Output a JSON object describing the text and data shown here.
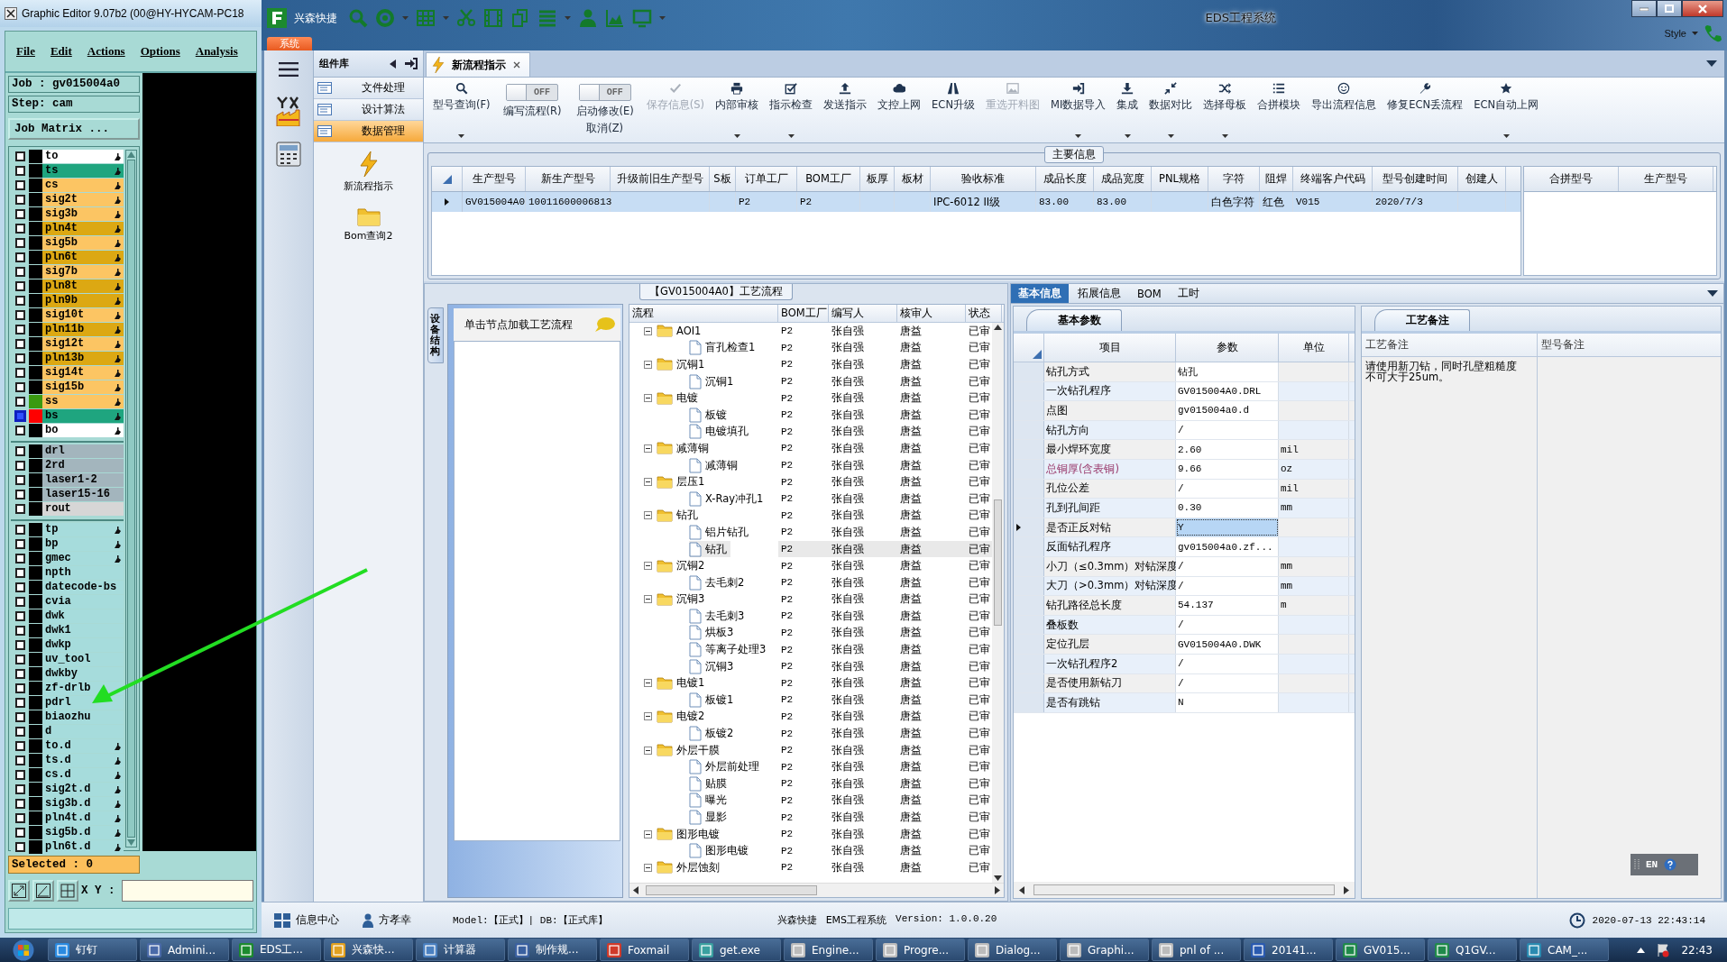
{
  "graphic_editor": {
    "title": "Graphic Editor 9.07b2 (00@HY-HYCAM-PC18",
    "menu": [
      "File",
      "Edit",
      "Actions",
      "Options",
      "Analysis"
    ],
    "job": "Job : gv015004a0",
    "step": "Step: cam",
    "job_matrix_button": "Job Matrix ...",
    "layer_groups": [
      {
        "layers": [
          {
            "name": "to",
            "color": "#ffffff",
            "affected": true,
            "selected": false
          },
          {
            "name": "ts",
            "color": "#1fa57f",
            "affected": true,
            "selected": false
          },
          {
            "name": "cs",
            "color": "#fcc563",
            "affected": true,
            "selected": false
          },
          {
            "name": "sig2t",
            "color": "#fcc563",
            "affected": true,
            "selected": false
          },
          {
            "name": "sig3b",
            "color": "#fcc563",
            "affected": true,
            "selected": false
          },
          {
            "name": "pln4t",
            "color": "#dca813",
            "affected": true,
            "selected": false
          },
          {
            "name": "sig5b",
            "color": "#fcc563",
            "affected": true,
            "selected": false
          },
          {
            "name": "pln6t",
            "color": "#dca813",
            "affected": true,
            "selected": false
          },
          {
            "name": "sig7b",
            "color": "#fcc563",
            "affected": true,
            "selected": false
          },
          {
            "name": "pln8t",
            "color": "#dca813",
            "affected": true,
            "selected": false
          },
          {
            "name": "pln9b",
            "color": "#dca813",
            "affected": true,
            "selected": false
          },
          {
            "name": "sig10t",
            "color": "#fcc563",
            "affected": true,
            "selected": false
          },
          {
            "name": "pln11b",
            "color": "#dca813",
            "affected": true,
            "selected": false
          },
          {
            "name": "sig12t",
            "color": "#fcc563",
            "affected": true,
            "selected": false
          },
          {
            "name": "pln13b",
            "color": "#dca813",
            "affected": true,
            "selected": false
          },
          {
            "name": "sig14t",
            "color": "#fcc563",
            "affected": true,
            "selected": false
          },
          {
            "name": "sig15b",
            "color": "#fcc563",
            "affected": true,
            "selected": false
          },
          {
            "name": "ss",
            "color": "#fcc563",
            "affected": true,
            "selected": false,
            "swatch": {
              "color": "#3a9a10"
            }
          },
          {
            "name": "bs",
            "color": "#1fa57f",
            "affected": true,
            "selected": true,
            "swatch": {
              "color": "#ff0000"
            }
          },
          {
            "name": "bo",
            "color": "#ffffff",
            "affected": true,
            "selected": false
          }
        ]
      },
      {
        "layers": [
          {
            "name": "drl",
            "color": "#a3b5bd",
            "affected": false,
            "selected": false
          },
          {
            "name": "2rd",
            "color": "#a3b5bd",
            "affected": false,
            "selected": false
          },
          {
            "name": "laser1-2",
            "color": "#a3b5bd",
            "affected": false,
            "selected": false
          },
          {
            "name": "laser15-16",
            "color": "#a3b5bd",
            "affected": false,
            "selected": false
          },
          {
            "name": "rout",
            "color": "#d6d6d6",
            "affected": false,
            "selected": false
          }
        ]
      },
      {
        "layers": [
          {
            "name": "tp",
            "color": "#a6dcdc",
            "affected": true,
            "selected": false
          },
          {
            "name": "bp",
            "color": "#a6dcdc",
            "affected": true,
            "selected": false
          },
          {
            "name": "gmec",
            "color": "#a6dcdc",
            "affected": true,
            "selected": false
          },
          {
            "name": "npth",
            "color": "#a6dcdc",
            "affected": false,
            "selected": false
          },
          {
            "name": "datecode-bs",
            "color": "#a6dcdc",
            "affected": false,
            "selected": false
          },
          {
            "name": "cvia",
            "color": "#a6dcdc",
            "affected": false,
            "selected": false
          },
          {
            "name": "dwk",
            "color": "#a6dcdc",
            "affected": false,
            "selected": false
          },
          {
            "name": "dwk1",
            "color": "#a6dcdc",
            "affected": false,
            "selected": false
          },
          {
            "name": "dwkp",
            "color": "#a6dcdc",
            "affected": false,
            "selected": false
          },
          {
            "name": "uv_tool",
            "color": "#a6dcdc",
            "affected": false,
            "selected": false
          },
          {
            "name": "dwkby",
            "color": "#a6dcdc",
            "affected": false,
            "selected": false
          },
          {
            "name": "zf-drlb",
            "color": "#a6dcdc",
            "affected": false,
            "selected": false
          },
          {
            "name": "pdrl",
            "color": "#a6dcdc",
            "affected": false,
            "selected": false
          },
          {
            "name": "biaozhu",
            "color": "#a6dcdc",
            "affected": false,
            "selected": false
          },
          {
            "name": "d",
            "color": "#a6dcdc",
            "affected": false,
            "selected": false
          },
          {
            "name": "to.d",
            "color": "#a6dcdc",
            "affected": true,
            "selected": false
          },
          {
            "name": "ts.d",
            "color": "#a6dcdc",
            "affected": true,
            "selected": false
          },
          {
            "name": "cs.d",
            "color": "#a6dcdc",
            "affected": true,
            "selected": false
          },
          {
            "name": "sig2t.d",
            "color": "#a6dcdc",
            "affected": true,
            "selected": false
          },
          {
            "name": "sig3b.d",
            "color": "#a6dcdc",
            "affected": true,
            "selected": false
          },
          {
            "name": "pln4t.d",
            "color": "#a6dcdc",
            "affected": true,
            "selected": false
          },
          {
            "name": "sig5b.d",
            "color": "#a6dcdc",
            "affected": true,
            "selected": false
          },
          {
            "name": "pln6t.d",
            "color": "#a6dcdc",
            "affected": true,
            "selected": false
          }
        ]
      }
    ],
    "selected_count": "Selected : 0",
    "xy_label": "X Y :"
  },
  "eds": {
    "title": "EDS工程系统",
    "quick_bar_label": "兴森快捷",
    "style_label": "Style",
    "system_tab": "系统",
    "nav": {
      "header": "组件库",
      "items": [
        {
          "label": "文件处理",
          "selected": false
        },
        {
          "label": "设计算法",
          "selected": false
        },
        {
          "label": "数据管理",
          "selected": true
        }
      ],
      "shortcuts": [
        "新流程指示",
        "Bom查询2"
      ]
    },
    "doc_tabs": [
      {
        "label": "新流程指示",
        "selected": true
      }
    ],
    "ribbon": [
      {
        "kind": "button",
        "label": "型号查询(F)",
        "dropdown": true,
        "disabled": false
      },
      {
        "kind": "toggle",
        "label": "编写流程(R)",
        "switch_text": "OFF",
        "on": false
      },
      {
        "kind": "toggle",
        "label": "启动修改(E)",
        "sublabel": "取消(Z)",
        "switch_text": "OFF",
        "on": false
      },
      {
        "kind": "button",
        "label": "保存信息(S)",
        "dropdown": false,
        "disabled": true
      },
      {
        "kind": "button",
        "label": "内部审核",
        "dropdown": true,
        "disabled": false
      },
      {
        "kind": "button",
        "label": "指示检查",
        "dropdown": true,
        "disabled": false
      },
      {
        "kind": "button",
        "label": "发送指示",
        "dropdown": false,
        "disabled": false
      },
      {
        "kind": "button",
        "label": "文控上网",
        "dropdown": false,
        "disabled": false
      },
      {
        "kind": "button",
        "label": "ECN升级",
        "dropdown": false,
        "disabled": false
      },
      {
        "kind": "button",
        "label": "重选开料图",
        "dropdown": false,
        "disabled": true
      },
      {
        "kind": "button",
        "label": "MI数据导入",
        "dropdown": true,
        "disabled": false
      },
      {
        "kind": "button",
        "label": "集成",
        "dropdown": true,
        "disabled": false
      },
      {
        "kind": "button",
        "label": "数据对比",
        "dropdown": true,
        "disabled": false
      },
      {
        "kind": "button",
        "label": "选择母板",
        "dropdown": true,
        "disabled": false
      },
      {
        "kind": "button",
        "label": "合拼模块",
        "dropdown": false,
        "disabled": false
      },
      {
        "kind": "button",
        "label": "导出流程信息",
        "dropdown": false,
        "disabled": false
      },
      {
        "kind": "button",
        "label": "修复ECN丢流程",
        "dropdown": false,
        "disabled": false
      },
      {
        "kind": "button",
        "label": "ECN自动上网",
        "dropdown": true,
        "disabled": false
      }
    ],
    "main_info": {
      "title": "主要信息",
      "columns": [
        "生产型号",
        "新生产型号",
        "升级前旧生产型号",
        "S板",
        "订单工厂",
        "BOM工厂",
        "板厚",
        "板材",
        "验收标准",
        "成品长度",
        "成品宽度",
        "PNL规格",
        "字符",
        "阻焊",
        "终端客户代码",
        "型号创建时间",
        "创建人"
      ],
      "rows": [
        {
          "selected": true,
          "cells": [
            "GV015004A0",
            "10011600006813",
            null,
            null,
            "P2",
            "P2",
            null,
            null,
            "IPC-6012 II级",
            "83.00",
            "83.00",
            null,
            "白色字符",
            "红色",
            "V015",
            "2020/7/3",
            null
          ]
        }
      ],
      "side_columns": [
        "合拼型号",
        "生产型号"
      ]
    },
    "flow": {
      "title": "【GV015004A0】工艺流程",
      "side_tab": "设备结构",
      "hint": "单击节点加载工艺流程",
      "columns": [
        "流程",
        "BOM工厂",
        "编写人",
        "核审人",
        "状态"
      ],
      "nodes": [
        {
          "label": "AOI1",
          "cells": [
            "P2",
            "张自强",
            "唐益",
            "已审"
          ],
          "expanded": true,
          "selected": false,
          "children": [
            {
              "label": "盲孔检查1",
              "cells": [
                "P2",
                "张自强",
                "唐益",
                "已审"
              ],
              "selected": false
            }
          ]
        },
        {
          "label": "沉铜1",
          "cells": [
            "P2",
            "张自强",
            "唐益",
            "已审"
          ],
          "expanded": true,
          "selected": false,
          "children": [
            {
              "label": "沉铜1",
              "cells": [
                "P2",
                "张自强",
                "唐益",
                "已审"
              ],
              "selected": false
            }
          ]
        },
        {
          "label": "电镀",
          "cells": [
            "P2",
            "张自强",
            "唐益",
            "已审"
          ],
          "expanded": true,
          "selected": false,
          "children": [
            {
              "label": "板镀",
              "cells": [
                "P2",
                "张自强",
                "唐益",
                "已审"
              ],
              "selected": false
            },
            {
              "label": "电镀填孔",
              "cells": [
                "P2",
                "张自强",
                "唐益",
                "已审"
              ],
              "selected": false
            }
          ]
        },
        {
          "label": "减薄铜",
          "cells": [
            "P2",
            "张自强",
            "唐益",
            "已审"
          ],
          "expanded": true,
          "selected": false,
          "children": [
            {
              "label": "减薄铜",
              "cells": [
                "P2",
                "张自强",
                "唐益",
                "已审"
              ],
              "selected": false
            }
          ]
        },
        {
          "label": "层压1",
          "cells": [
            "P2",
            "张自强",
            "唐益",
            "已审"
          ],
          "expanded": true,
          "selected": false,
          "children": [
            {
              "label": "X-Ray冲孔1",
              "cells": [
                "P2",
                "张自强",
                "唐益",
                "已审"
              ],
              "selected": false
            }
          ]
        },
        {
          "label": "钻孔",
          "cells": [
            "P2",
            "张自强",
            "唐益",
            "已审"
          ],
          "expanded": true,
          "selected": false,
          "children": [
            {
              "label": "铝片钻孔",
              "cells": [
                "P2",
                "张自强",
                "唐益",
                "已审"
              ],
              "selected": false
            },
            {
              "label": "钻孔",
              "cells": [
                "P2",
                "张自强",
                "唐益",
                "已审"
              ],
              "selected": true
            }
          ]
        },
        {
          "label": "沉铜2",
          "cells": [
            "P2",
            "张自强",
            "唐益",
            "已审"
          ],
          "expanded": true,
          "selected": false,
          "children": [
            {
              "label": "去毛刺2",
              "cells": [
                "P2",
                "张自强",
                "唐益",
                "已审"
              ],
              "selected": false
            }
          ]
        },
        {
          "label": "沉铜3",
          "cells": [
            "P2",
            "张自强",
            "唐益",
            "已审"
          ],
          "expanded": true,
          "selected": false,
          "children": [
            {
              "label": "去毛刺3",
              "cells": [
                "P2",
                "张自强",
                "唐益",
                "已审"
              ],
              "selected": false
            },
            {
              "label": "烘板3",
              "cells": [
                "P2",
                "张自强",
                "唐益",
                "已审"
              ],
              "selected": false
            },
            {
              "label": "等离子处理3",
              "cells": [
                "P2",
                "张自强",
                "唐益",
                "已审"
              ],
              "selected": false
            },
            {
              "label": "沉铜3",
              "cells": [
                "P2",
                "张自强",
                "唐益",
                "已审"
              ],
              "selected": false
            }
          ]
        },
        {
          "label": "电镀1",
          "cells": [
            "P2",
            "张自强",
            "唐益",
            "已审"
          ],
          "expanded": true,
          "selected": false,
          "children": [
            {
              "label": "板镀1",
              "cells": [
                "P2",
                "张自强",
                "唐益",
                "已审"
              ],
              "selected": false
            }
          ]
        },
        {
          "label": "电镀2",
          "cells": [
            "P2",
            "张自强",
            "唐益",
            "已审"
          ],
          "expanded": true,
          "selected": false,
          "children": [
            {
              "label": "板镀2",
              "cells": [
                "P2",
                "张自强",
                "唐益",
                "已审"
              ],
              "selected": false
            }
          ]
        },
        {
          "label": "外层干膜",
          "cells": [
            "P2",
            "张自强",
            "唐益",
            "已审"
          ],
          "expanded": true,
          "selected": false,
          "children": [
            {
              "label": "外层前处理",
              "cells": [
                "P2",
                "张自强",
                "唐益",
                "已审"
              ],
              "selected": false
            },
            {
              "label": "贴膜",
              "cells": [
                "P2",
                "张自强",
                "唐益",
                "已审"
              ],
              "selected": false
            },
            {
              "label": "曝光",
              "cells": [
                "P2",
                "张自强",
                "唐益",
                "已审"
              ],
              "selected": false
            },
            {
              "label": "显影",
              "cells": [
                "P2",
                "张自强",
                "唐益",
                "已审"
              ],
              "selected": false
            }
          ]
        },
        {
          "label": "图形电镀",
          "cells": [
            "P2",
            "张自强",
            "唐益",
            "已审"
          ],
          "expanded": true,
          "selected": false,
          "children": [
            {
              "label": "图形电镀",
              "cells": [
                "P2",
                "张自强",
                "唐益",
                "已审"
              ],
              "selected": false
            }
          ]
        },
        {
          "label": "外层蚀刻",
          "cells": [
            "P2",
            "张自强",
            "唐益",
            "已审"
          ],
          "expanded": true,
          "selected": false
        }
      ]
    },
    "info": {
      "tabs": [
        {
          "label": "基本信息",
          "selected": true
        },
        {
          "label": "拓展信息",
          "selected": false
        },
        {
          "label": "BOM",
          "selected": false
        },
        {
          "label": "工时",
          "selected": false
        }
      ],
      "params_tab": "基本参数",
      "param_columns": [
        "项目",
        "参数",
        "单位"
      ],
      "params": [
        {
          "item": "钻孔方式",
          "value": "钻孔",
          "emphasized": false,
          "selected": false
        },
        {
          "item": "一次钻孔程序",
          "value": "GV015004A0.DRL",
          "emphasized": false,
          "selected": false
        },
        {
          "item": "点图",
          "value": "gv015004a0.d",
          "emphasized": false,
          "selected": false
        },
        {
          "item": "钻孔方向",
          "value": "/",
          "emphasized": false,
          "selected": false
        },
        {
          "item": "最小焊环宽度",
          "value": "2.60",
          "unit": "mil",
          "emphasized": false,
          "selected": false
        },
        {
          "item": "总铜厚(含表铜)",
          "value": "9.66",
          "unit": "oz",
          "emphasized": true,
          "selected": false
        },
        {
          "item": "孔位公差",
          "value": "/",
          "unit": "mil",
          "emphasized": false,
          "selected": false
        },
        {
          "item": "孔到孔间距",
          "value": "0.30",
          "unit": "mm",
          "emphasized": false,
          "selected": false
        },
        {
          "item": "是否正反对钻",
          "value": "Y",
          "emphasized": false,
          "selected": true
        },
        {
          "item": "反面钻孔程序",
          "value": "gv015004a0.zf...",
          "emphasized": false,
          "selected": false
        },
        {
          "item": "小刀（≤0.3mm）对钻深度",
          "value": "/",
          "unit": "mm",
          "emphasized": false,
          "selected": false
        },
        {
          "item": "大刀（>0.3mm）对钻深度",
          "value": "/",
          "unit": "mm",
          "emphasized": false,
          "selected": false
        },
        {
          "item": "钻孔路径总长度",
          "value": "54.137",
          "unit": "m",
          "emphasized": false,
          "selected": false
        },
        {
          "item": "叠板数",
          "value": "/",
          "emphasized": false,
          "selected": false
        },
        {
          "item": "定位孔层",
          "value": "GV015004A0.DWK",
          "emphasized": false,
          "selected": false
        },
        {
          "item": "一次钻孔程序2",
          "value": "/",
          "emphasized": false,
          "selected": false
        },
        {
          "item": "是否使用新钻刀",
          "value": "/",
          "emphasized": false,
          "selected": false
        },
        {
          "item": "是否有跳钻",
          "value": "N",
          "emphasized": false,
          "selected": false
        }
      ],
      "remarks_tab": "工艺备注",
      "remark_columns": [
        "工艺备注",
        "型号备注"
      ],
      "process_remark": "请使用新刀钻，同时孔壁粗糙度不可大于25um。",
      "ime_label": "EN"
    },
    "status_bar": {
      "info_center": "信息中心",
      "user": "方孝幸",
      "model": "Model:【正式】| DB:【正式库】",
      "app": "兴森快捷",
      "system": "EMS工程系统",
      "version": "Version: 1.0.0.20",
      "datetime": "2020-07-13 22:43:14"
    }
  },
  "taskbar": {
    "items": [
      "钉钉",
      "Admini...",
      "EDS工...",
      "兴森快...",
      "计算器",
      "制作规...",
      "Foxmail",
      "get.exe",
      "Engine...",
      "Progre...",
      "Dialog...",
      "Graphi...",
      "pnl of ...",
      "20141...",
      "GV015...",
      "Q1GV...",
      "CAM_..."
    ],
    "clock": "22:43"
  }
}
